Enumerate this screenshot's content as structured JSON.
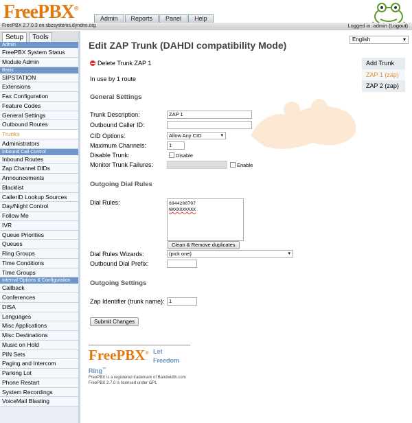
{
  "header": {
    "logo_text": "FreePBX",
    "version_text": "FreePBX 2.7.0.3 on sbzsystems.dyndns.org",
    "logged_in_text": "Logged in: admin",
    "logout_label": "(Logout)",
    "nav": [
      "Admin",
      "Reports",
      "Panel",
      "Help"
    ],
    "language": "English"
  },
  "sidebar": {
    "tabs": [
      "Setup",
      "Tools"
    ],
    "sections": [
      {
        "title": "Admin",
        "items": [
          "FreePBX System Status",
          "Module Admin"
        ]
      },
      {
        "title": "Basic",
        "items": [
          "SIPSTATION",
          "Extensions",
          "Fax Configuration",
          "Feature Codes",
          "General Settings",
          "Outbound Routes",
          "Trunks",
          "Administrators"
        ]
      },
      {
        "title": "Inbound Call Control",
        "items": [
          "Inbound Routes",
          "Zap Channel DIDs",
          "Announcements",
          "Blacklist",
          "CallerID Lookup Sources",
          "Day/Night Control",
          "Follow Me",
          "IVR",
          "Queue Priorities",
          "Queues",
          "Ring Groups",
          "Time Conditions",
          "Time Groups"
        ]
      },
      {
        "title": "Internal Options & Configuration",
        "items": [
          "Callback",
          "Conferences",
          "DISA",
          "Languages",
          "Misc Applications",
          "Misc Destinations",
          "Music on Hold",
          "PIN Sets",
          "Paging and Intercom",
          "Parking Lot",
          "Phone Restart",
          "System Recordings",
          "VoiceMail Blasting"
        ]
      }
    ],
    "active_item": "Trunks"
  },
  "main": {
    "title": "Edit ZAP Trunk (DAHDI compatibility Mode)",
    "delete_label": "Delete Trunk ZAP 1",
    "in_use": "In use by 1 route",
    "general_settings": "General Settings",
    "trunk_description_label": "Trunk Description:",
    "trunk_description_value": "ZAP 1",
    "outbound_cid_label": "Outbound Caller ID:",
    "outbound_cid_value": "",
    "cid_options_label": "CID Options:",
    "cid_options_value": "Allow Any CID",
    "max_channels_label": "Maximum Channels:",
    "max_channels_value": "1",
    "disable_trunk_label": "Disable Trunk:",
    "disable_text": "Disable",
    "monitor_label": "Monitor Trunk Failures:",
    "enable_text": "Enable",
    "outgoing_dial_rules": "Outgoing Dial Rules",
    "dial_rules_label": "Dial Rules:",
    "dial_rules_lines": [
      "6944208707",
      "NXXXXXXXXX"
    ],
    "clean_button": "Clean & Remove duplicates",
    "wizards_label": "Dial Rules Wizards:",
    "wizards_value": "(pick one)",
    "prefix_label": "Outbound Dial Prefix:",
    "prefix_value": "",
    "outgoing_settings": "Outgoing Settings",
    "zap_identifier_label": "Zap Identifier (trunk name):",
    "zap_identifier_value": "1",
    "submit_label": "Submit Changes"
  },
  "rightnav": {
    "items": [
      "Add Trunk",
      "ZAP 1 (zap)",
      "ZAP 2 (zap)"
    ],
    "active": "ZAP 1 (zap)"
  },
  "footer": {
    "logo_text": "FreePBX",
    "tagline_1": "Let",
    "tagline_2": "Freedom",
    "tagline_3": "Ring",
    "tm": "™",
    "trademark_text": "FreePBX is a registered trademark of Bandwidth.com",
    "license_text": "FreePBX 2.7.0 is licensed under GPL"
  },
  "colors": {
    "accent": "#e07a10",
    "sidebar_section": "#6d97c9",
    "active_link": "#e49030"
  }
}
